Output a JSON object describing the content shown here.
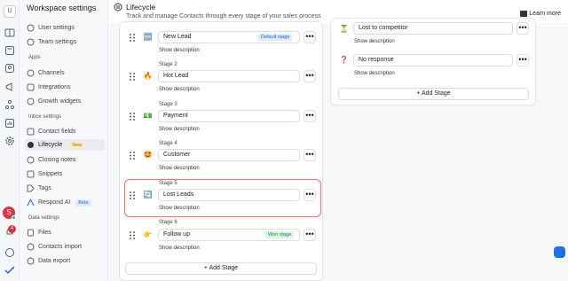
{
  "workspace": {
    "initial": "U"
  },
  "sidebar": {
    "title": "Workspace settings",
    "items": [
      {
        "label": "User settings",
        "icon": "user-settings-icon"
      },
      {
        "label": "Team settings",
        "icon": "team-icon"
      }
    ],
    "apps_label": "Apps",
    "apps": [
      {
        "label": "Channels",
        "icon": "channels-icon"
      },
      {
        "label": "Integrations",
        "icon": "integrations-icon"
      },
      {
        "label": "Growth widgets",
        "icon": "widget-icon"
      }
    ],
    "inbox_label": "Inbox settings",
    "inbox": [
      {
        "label": "Contact fields",
        "icon": "contact-fields-icon"
      },
      {
        "label": "Lifecycle",
        "icon": "lifecycle-icon",
        "badge": "New"
      },
      {
        "label": "Closing notes",
        "icon": "closing-notes-icon"
      },
      {
        "label": "Snippets",
        "icon": "snippets-icon"
      },
      {
        "label": "Tags",
        "icon": "tag-icon"
      },
      {
        "label": "Respond AI",
        "icon": "ai-icon",
        "badge": "Beta"
      }
    ],
    "data_label": "Data settings",
    "data": [
      {
        "label": "Files",
        "icon": "files-icon"
      },
      {
        "label": "Contacts import",
        "icon": "import-icon"
      },
      {
        "label": "Data export",
        "icon": "export-icon"
      }
    ]
  },
  "user": {
    "initial": "S",
    "notifications": "4"
  },
  "header": {
    "title": "Lifecycle",
    "subtitle": "Track and manage Contacts through every stage of your sales process",
    "learn_more": "Learn more"
  },
  "lifecycle": {
    "stages": [
      {
        "stage": "",
        "emoji": "🆕",
        "name": "New Lead",
        "tag": "Default stage",
        "show": "Show description"
      },
      {
        "stage": "Stage 2",
        "emoji": "🔥",
        "name": "Hot Lead",
        "show": "Show description"
      },
      {
        "stage": "Stage 3",
        "emoji": "💵",
        "name": "Payment",
        "show": "Show description"
      },
      {
        "stage": "Stage 4",
        "emoji": "🤩",
        "name": "Customer",
        "show": "Show description"
      },
      {
        "stage": "Stage 5",
        "emoji": "🔄",
        "name": "Lost Leads",
        "show": "Show description"
      },
      {
        "stage": "Stage 6",
        "emoji": "👉",
        "name": "Follow up",
        "tag": "Won stage",
        "show": "Show description"
      }
    ],
    "add_stage": "Add Stage"
  },
  "lost": {
    "stages": [
      {
        "emoji": "⏳",
        "name": "Lost to competitor",
        "show": "Show description"
      },
      {
        "emoji": "❓",
        "name": "No response",
        "show": "Show description"
      }
    ],
    "add_stage": "Add Stage"
  },
  "more_label": "•••"
}
